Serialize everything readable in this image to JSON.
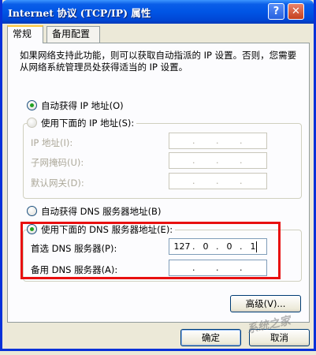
{
  "window": {
    "title": "Internet 协议 (TCP/IP) 属性",
    "help_label": "?",
    "close_label": "✕"
  },
  "tabs": [
    {
      "label": "常规",
      "active": true
    },
    {
      "label": "备用配置",
      "active": false
    }
  ],
  "description": "如果网络支持此功能，则可以获取自动指派的 IP 设置。否则，您需要从网络系统管理员处获得适当的 IP 设置。",
  "ip": {
    "auto_label": "自动获得 IP 地址(O)",
    "auto_checked": true,
    "manual_label": "使用下面的 IP 地址(S):",
    "manual_checked": false,
    "fields": [
      {
        "label": "IP 地址(I):"
      },
      {
        "label": "子网掩码(U):"
      },
      {
        "label": "默认网关(D):"
      }
    ]
  },
  "dns": {
    "auto_label": "自动获得 DNS 服务器地址(B)",
    "auto_checked": false,
    "manual_label": "使用下面的 DNS 服务器地址(E):",
    "manual_checked": true,
    "preferred_label": "首选 DNS 服务器(P):",
    "preferred_value": [
      "127",
      "0",
      "0",
      "1"
    ],
    "alternate_label": "备用 DNS 服务器(A):",
    "alternate_value": [
      "",
      "",
      "",
      ""
    ]
  },
  "buttons": {
    "advanced": "高级(V)...",
    "ok": "确定",
    "cancel": "取消"
  },
  "watermark": "系统之家",
  "colors": {
    "title_bar": "#0055e5",
    "highlight_box": "#e81010",
    "radio_checked": "#21a121"
  }
}
